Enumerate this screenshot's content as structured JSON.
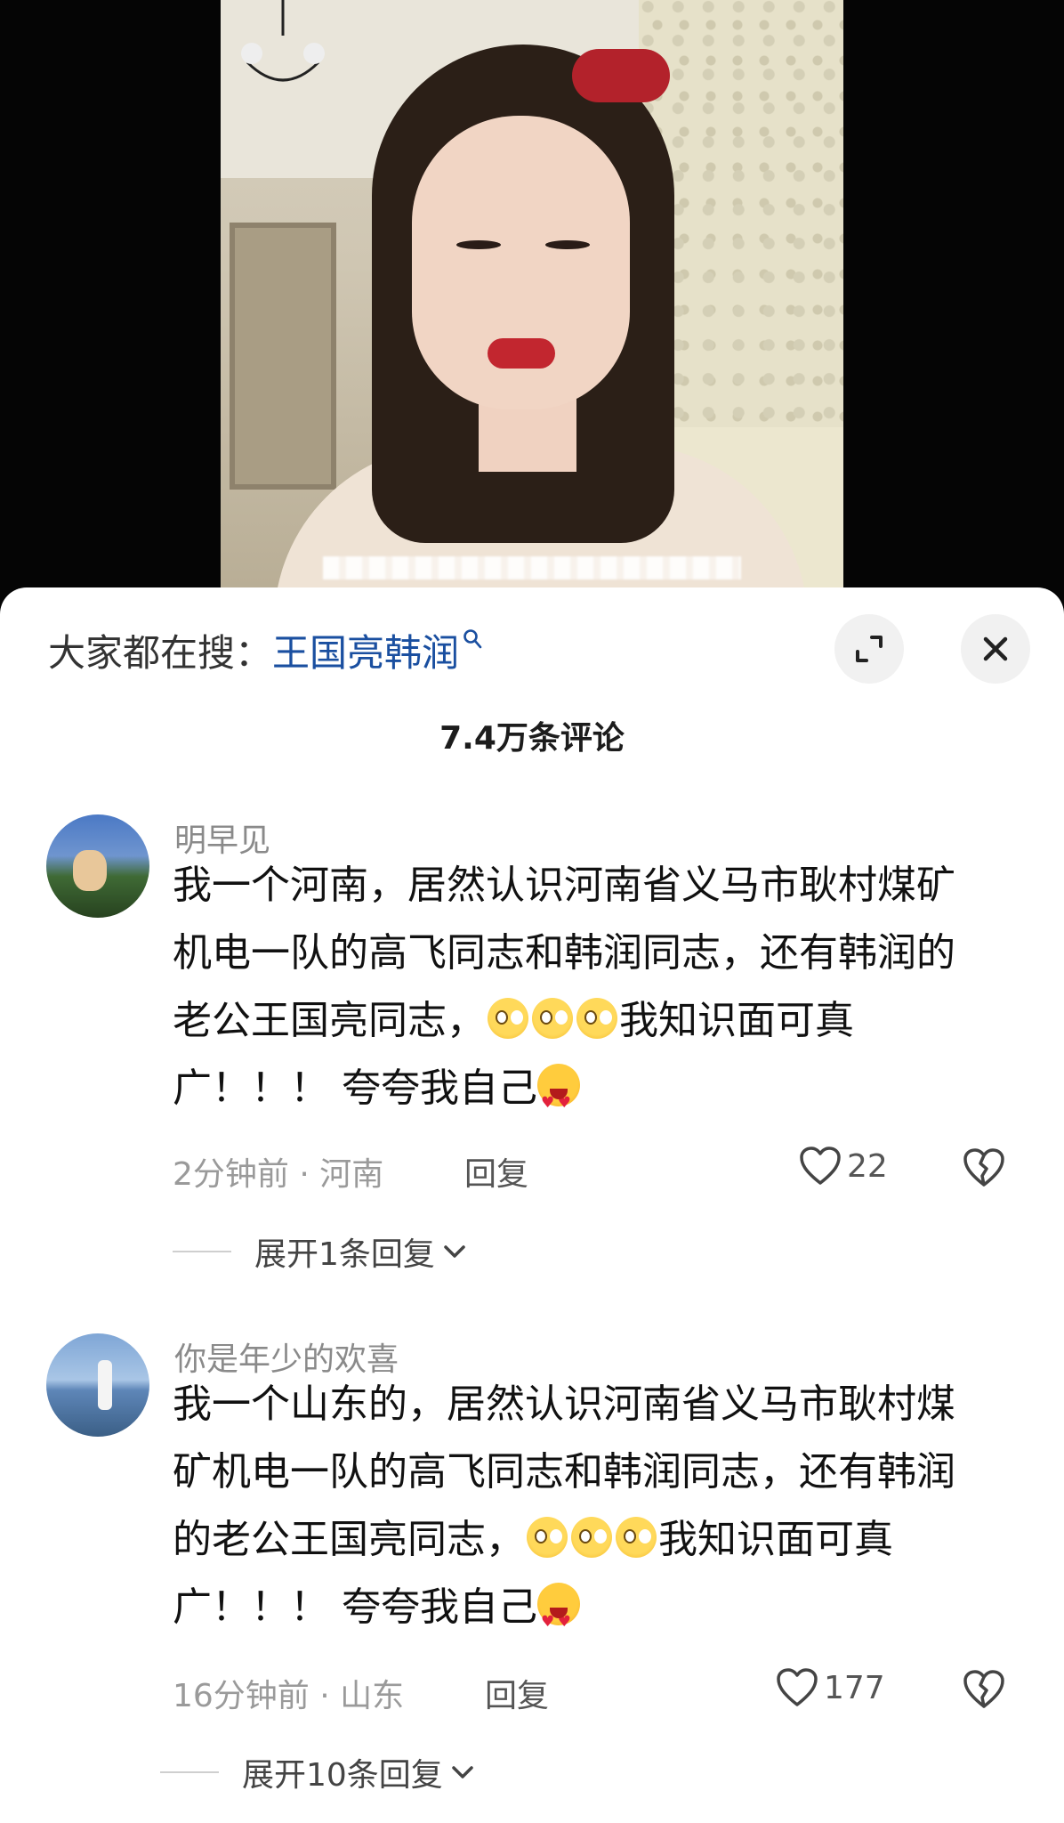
{
  "search_hint": {
    "prefix": "大家都在搜：",
    "keyword": "王国亮韩润"
  },
  "comment_count": "7.4万条评论",
  "icons": {
    "expand": "expand-icon",
    "close": "close-icon",
    "search": "search-icon",
    "like": "heart-icon",
    "dislike": "broken-heart-icon",
    "chevron": "chevron-down-icon"
  },
  "colors": {
    "keyword": "#1a4fa0",
    "text": "#111111",
    "meta": "#9a9a9a"
  },
  "comments": [
    {
      "username": "明早见",
      "text_1": "我一个河南，居然认识河南省义马市耿村煤矿机电一队的高飞同志和韩润同志，还有韩润的老公王国亮同志，",
      "text_2": "我知识面可真广！！！ 夸夸我自己",
      "time": "2分钟前",
      "location": "河南",
      "reply_label": "回复",
      "likes": "22",
      "expand_label": "展开1条回复"
    },
    {
      "username": "你是年少的欢喜",
      "text_1": "我一个山东的，居然认识河南省义马市耿村煤矿机电一队的高飞同志和韩润同志，还有韩润的老公王国亮同志，",
      "text_2": "我知识面可真广！！！ 夸夸我自己",
      "time": "16分钟前",
      "location": "山东",
      "reply_label": "回复",
      "likes": "177",
      "expand_label": "展开10条回复"
    }
  ]
}
